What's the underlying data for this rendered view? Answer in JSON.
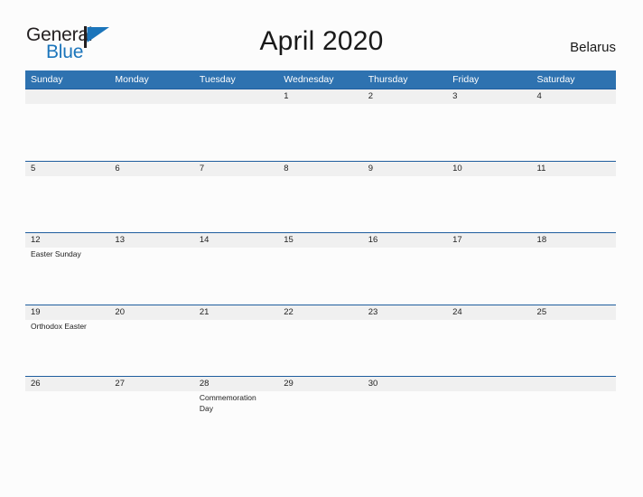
{
  "brand": {
    "name_part1": "General",
    "name_part2": "Blue",
    "flag_icon": "blue-flag-triangle",
    "color_dark": "#231f20",
    "color_blue": "#1b75bb"
  },
  "header": {
    "title": "April 2020",
    "region": "Belarus"
  },
  "theme": {
    "header_blue": "#2e72b0",
    "row_divider_blue": "#1f5d9e",
    "daynum_band_gray": "#f0f0f0",
    "page_background": "#fcfcfc",
    "text": "#222222"
  },
  "calendar": {
    "weekdays": [
      "Sunday",
      "Monday",
      "Tuesday",
      "Wednesday",
      "Thursday",
      "Friday",
      "Saturday"
    ],
    "weeks": [
      [
        {
          "day": "",
          "event": ""
        },
        {
          "day": "",
          "event": ""
        },
        {
          "day": "",
          "event": ""
        },
        {
          "day": "1",
          "event": ""
        },
        {
          "day": "2",
          "event": ""
        },
        {
          "day": "3",
          "event": ""
        },
        {
          "day": "4",
          "event": ""
        }
      ],
      [
        {
          "day": "5",
          "event": ""
        },
        {
          "day": "6",
          "event": ""
        },
        {
          "day": "7",
          "event": ""
        },
        {
          "day": "8",
          "event": ""
        },
        {
          "day": "9",
          "event": ""
        },
        {
          "day": "10",
          "event": ""
        },
        {
          "day": "11",
          "event": ""
        }
      ],
      [
        {
          "day": "12",
          "event": "Easter Sunday"
        },
        {
          "day": "13",
          "event": ""
        },
        {
          "day": "14",
          "event": ""
        },
        {
          "day": "15",
          "event": ""
        },
        {
          "day": "16",
          "event": ""
        },
        {
          "day": "17",
          "event": ""
        },
        {
          "day": "18",
          "event": ""
        }
      ],
      [
        {
          "day": "19",
          "event": "Orthodox Easter"
        },
        {
          "day": "20",
          "event": ""
        },
        {
          "day": "21",
          "event": ""
        },
        {
          "day": "22",
          "event": ""
        },
        {
          "day": "23",
          "event": ""
        },
        {
          "day": "24",
          "event": ""
        },
        {
          "day": "25",
          "event": ""
        }
      ],
      [
        {
          "day": "26",
          "event": ""
        },
        {
          "day": "27",
          "event": ""
        },
        {
          "day": "28",
          "event": "Commemoration Day"
        },
        {
          "day": "29",
          "event": ""
        },
        {
          "day": "30",
          "event": ""
        },
        {
          "day": "",
          "event": ""
        },
        {
          "day": "",
          "event": ""
        }
      ]
    ]
  }
}
